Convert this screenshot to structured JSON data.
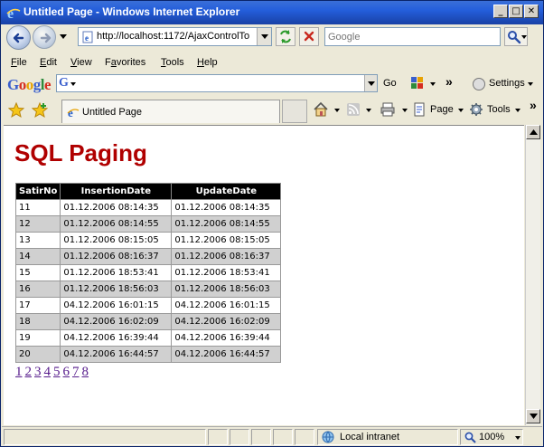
{
  "window": {
    "title": "Untitled Page - Windows Internet Explorer",
    "minimize": "_",
    "maximize": "□",
    "close": "✕"
  },
  "address": {
    "url": "http://localhost:1172/AjaxControlTo",
    "search_placeholder": "Google"
  },
  "menu": [
    {
      "label": "File",
      "accel": "F",
      "rest": "ile"
    },
    {
      "label": "Edit",
      "accel": "E",
      "rest": "dit"
    },
    {
      "label": "View",
      "accel": "V",
      "rest": "iew"
    },
    {
      "label": "Favorites",
      "accel": "a",
      "pre": "F",
      "rest": "vorites"
    },
    {
      "label": "Tools",
      "accel": "T",
      "rest": "ools"
    },
    {
      "label": "Help",
      "accel": "H",
      "rest": "elp"
    }
  ],
  "google_toolbar": {
    "logo_letters": [
      {
        "ch": "G",
        "color": "#3a5fcd"
      },
      {
        "ch": "o",
        "color": "#d62d20"
      },
      {
        "ch": "o",
        "color": "#e8a202"
      },
      {
        "ch": "g",
        "color": "#3a5fcd"
      },
      {
        "ch": "l",
        "color": "#2e8b3d"
      },
      {
        "ch": "e",
        "color": "#d62d20"
      }
    ],
    "go_label": "Go",
    "more": "»",
    "settings_label": "Settings"
  },
  "tab": {
    "title": "Untitled Page"
  },
  "command_bar": {
    "page_label": "Page",
    "tools_label": "Tools",
    "more": "»"
  },
  "page": {
    "heading": "SQL Paging",
    "columns": [
      "SatirNo",
      "InsertionDate",
      "UpdateDate"
    ],
    "rows": [
      [
        "11",
        "01.12.2006 08:14:35",
        "01.12.2006 08:14:35"
      ],
      [
        "12",
        "01.12.2006 08:14:55",
        "01.12.2006 08:14:55"
      ],
      [
        "13",
        "01.12.2006 08:15:05",
        "01.12.2006 08:15:05"
      ],
      [
        "14",
        "01.12.2006 08:16:37",
        "01.12.2006 08:16:37"
      ],
      [
        "15",
        "01.12.2006 18:53:41",
        "01.12.2006 18:53:41"
      ],
      [
        "16",
        "01.12.2006 18:56:03",
        "01.12.2006 18:56:03"
      ],
      [
        "17",
        "04.12.2006 16:01:15",
        "04.12.2006 16:01:15"
      ],
      [
        "18",
        "04.12.2006 16:02:09",
        "04.12.2006 16:02:09"
      ],
      [
        "19",
        "04.12.2006 16:39:44",
        "04.12.2006 16:39:44"
      ],
      [
        "20",
        "04.12.2006 16:44:57",
        "04.12.2006 16:44:57"
      ]
    ],
    "pager": [
      "1",
      "2",
      "3",
      "4",
      "5",
      "6",
      "7",
      "8"
    ]
  },
  "status": {
    "zone": "Local intranet",
    "zoom": "100%"
  },
  "colors": {
    "heading": "#b00000",
    "header_bg": "#000000",
    "alt_row": "#d0d0d0",
    "link": "#551a8b"
  },
  "icons": [
    "ie-logo-icon",
    "back-arrow-icon",
    "forward-arrow-icon",
    "refresh-icon",
    "stop-icon",
    "search-icon",
    "favorites-star-icon",
    "add-favorites-icon",
    "home-icon",
    "feeds-icon",
    "print-icon",
    "page-icon",
    "tools-gear-icon",
    "globe-icon",
    "zoom-icon"
  ]
}
